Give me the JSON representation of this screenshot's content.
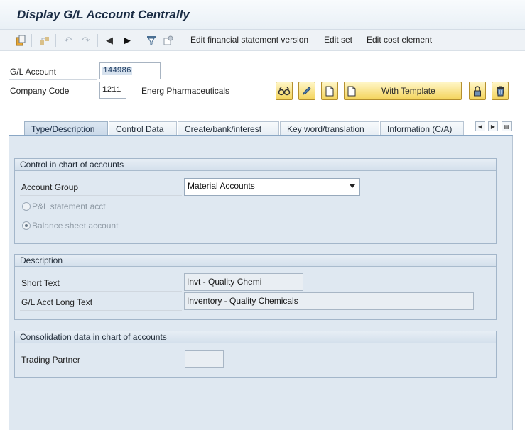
{
  "window": {
    "title": "Display G/L Account Centrally"
  },
  "toolbar": {
    "icons": [
      "clipboard-icon",
      "hierarchy-icon",
      "undo-icon",
      "redo-icon",
      "previous-icon",
      "next-icon",
      "filter-icon",
      "settings-icon"
    ],
    "edit_fs_version": "Edit financial statement version",
    "edit_set": "Edit set",
    "edit_cost_element": "Edit cost element"
  },
  "header": {
    "gl_account_label": "G/L Account",
    "gl_account_value": "144986",
    "company_code_label": "Company Code",
    "company_code_value": "1211",
    "company_name": "Energ Pharmaceuticals",
    "with_template_label": "With Template"
  },
  "tabs": [
    {
      "label": "Type/Description",
      "active": true
    },
    {
      "label": "Control Data",
      "active": false
    },
    {
      "label": "Create/bank/interest",
      "active": false
    },
    {
      "label": "Key word/translation",
      "active": false
    },
    {
      "label": "Information (C/A)",
      "active": false
    }
  ],
  "control_group": {
    "title": "Control in chart of accounts",
    "account_group_label": "Account Group",
    "account_group_value": "Material Accounts",
    "pl_label": "P&L statement acct",
    "balance_label": "Balance sheet account",
    "selected": "balance"
  },
  "description_group": {
    "title": "Description",
    "short_text_label": "Short Text",
    "short_text_value": "Invt - Quality Chemi",
    "long_text_label": "G/L Acct Long Text",
    "long_text_value": "Inventory - Quality Chemicals"
  },
  "consolidation_group": {
    "title": "Consolidation data in chart of accounts",
    "trading_partner_label": "Trading Partner",
    "trading_partner_value": ""
  },
  "colors": {
    "button_yellow": "#f4d45c",
    "panel_blue": "#dfe8f1",
    "tab_active": "#c9d8e8"
  }
}
